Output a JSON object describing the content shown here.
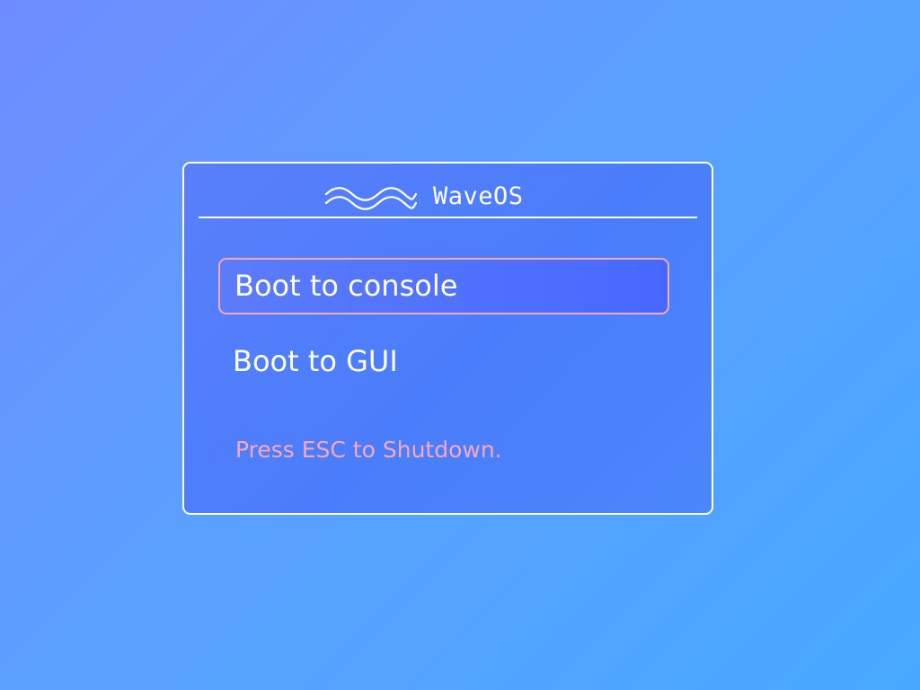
{
  "header": {
    "title": "WaveOS",
    "logo_icon": "wave-icon"
  },
  "menu": {
    "items": [
      {
        "label": "Boot to console",
        "selected": true
      },
      {
        "label": "Boot to GUI",
        "selected": false
      }
    ]
  },
  "footer": {
    "hint": "Press ESC to Shutdown."
  },
  "colors": {
    "background_start": "#6f8cff",
    "background_end": "#48a8ff",
    "panel": "#4a7dfb",
    "border": "#ffffff",
    "accent": "#f7a7c0",
    "selected_fill": "#4768ff"
  }
}
